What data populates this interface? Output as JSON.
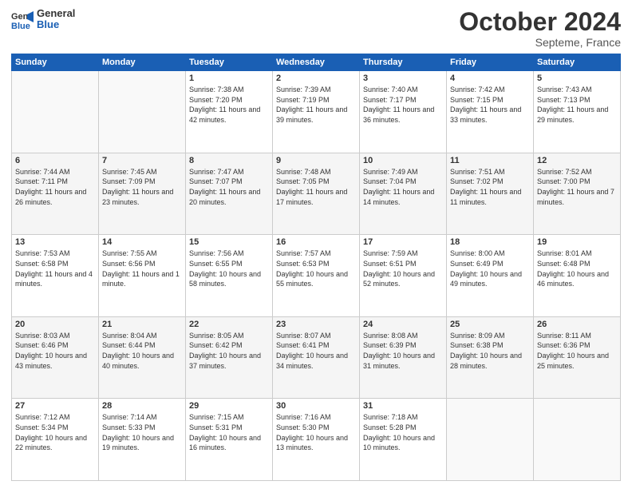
{
  "logo": {
    "line1": "General",
    "line2": "Blue"
  },
  "title": {
    "month": "October 2024",
    "location": "Septeme, France"
  },
  "weekdays": [
    "Sunday",
    "Monday",
    "Tuesday",
    "Wednesday",
    "Thursday",
    "Friday",
    "Saturday"
  ],
  "weeks": [
    [
      {
        "day": "",
        "sunrise": "",
        "sunset": "",
        "daylight": ""
      },
      {
        "day": "",
        "sunrise": "",
        "sunset": "",
        "daylight": ""
      },
      {
        "day": "1",
        "sunrise": "Sunrise: 7:38 AM",
        "sunset": "Sunset: 7:20 PM",
        "daylight": "Daylight: 11 hours and 42 minutes."
      },
      {
        "day": "2",
        "sunrise": "Sunrise: 7:39 AM",
        "sunset": "Sunset: 7:19 PM",
        "daylight": "Daylight: 11 hours and 39 minutes."
      },
      {
        "day": "3",
        "sunrise": "Sunrise: 7:40 AM",
        "sunset": "Sunset: 7:17 PM",
        "daylight": "Daylight: 11 hours and 36 minutes."
      },
      {
        "day": "4",
        "sunrise": "Sunrise: 7:42 AM",
        "sunset": "Sunset: 7:15 PM",
        "daylight": "Daylight: 11 hours and 33 minutes."
      },
      {
        "day": "5",
        "sunrise": "Sunrise: 7:43 AM",
        "sunset": "Sunset: 7:13 PM",
        "daylight": "Daylight: 11 hours and 29 minutes."
      }
    ],
    [
      {
        "day": "6",
        "sunrise": "Sunrise: 7:44 AM",
        "sunset": "Sunset: 7:11 PM",
        "daylight": "Daylight: 11 hours and 26 minutes."
      },
      {
        "day": "7",
        "sunrise": "Sunrise: 7:45 AM",
        "sunset": "Sunset: 7:09 PM",
        "daylight": "Daylight: 11 hours and 23 minutes."
      },
      {
        "day": "8",
        "sunrise": "Sunrise: 7:47 AM",
        "sunset": "Sunset: 7:07 PM",
        "daylight": "Daylight: 11 hours and 20 minutes."
      },
      {
        "day": "9",
        "sunrise": "Sunrise: 7:48 AM",
        "sunset": "Sunset: 7:05 PM",
        "daylight": "Daylight: 11 hours and 17 minutes."
      },
      {
        "day": "10",
        "sunrise": "Sunrise: 7:49 AM",
        "sunset": "Sunset: 7:04 PM",
        "daylight": "Daylight: 11 hours and 14 minutes."
      },
      {
        "day": "11",
        "sunrise": "Sunrise: 7:51 AM",
        "sunset": "Sunset: 7:02 PM",
        "daylight": "Daylight: 11 hours and 11 minutes."
      },
      {
        "day": "12",
        "sunrise": "Sunrise: 7:52 AM",
        "sunset": "Sunset: 7:00 PM",
        "daylight": "Daylight: 11 hours and 7 minutes."
      }
    ],
    [
      {
        "day": "13",
        "sunrise": "Sunrise: 7:53 AM",
        "sunset": "Sunset: 6:58 PM",
        "daylight": "Daylight: 11 hours and 4 minutes."
      },
      {
        "day": "14",
        "sunrise": "Sunrise: 7:55 AM",
        "sunset": "Sunset: 6:56 PM",
        "daylight": "Daylight: 11 hours and 1 minute."
      },
      {
        "day": "15",
        "sunrise": "Sunrise: 7:56 AM",
        "sunset": "Sunset: 6:55 PM",
        "daylight": "Daylight: 10 hours and 58 minutes."
      },
      {
        "day": "16",
        "sunrise": "Sunrise: 7:57 AM",
        "sunset": "Sunset: 6:53 PM",
        "daylight": "Daylight: 10 hours and 55 minutes."
      },
      {
        "day": "17",
        "sunrise": "Sunrise: 7:59 AM",
        "sunset": "Sunset: 6:51 PM",
        "daylight": "Daylight: 10 hours and 52 minutes."
      },
      {
        "day": "18",
        "sunrise": "Sunrise: 8:00 AM",
        "sunset": "Sunset: 6:49 PM",
        "daylight": "Daylight: 10 hours and 49 minutes."
      },
      {
        "day": "19",
        "sunrise": "Sunrise: 8:01 AM",
        "sunset": "Sunset: 6:48 PM",
        "daylight": "Daylight: 10 hours and 46 minutes."
      }
    ],
    [
      {
        "day": "20",
        "sunrise": "Sunrise: 8:03 AM",
        "sunset": "Sunset: 6:46 PM",
        "daylight": "Daylight: 10 hours and 43 minutes."
      },
      {
        "day": "21",
        "sunrise": "Sunrise: 8:04 AM",
        "sunset": "Sunset: 6:44 PM",
        "daylight": "Daylight: 10 hours and 40 minutes."
      },
      {
        "day": "22",
        "sunrise": "Sunrise: 8:05 AM",
        "sunset": "Sunset: 6:42 PM",
        "daylight": "Daylight: 10 hours and 37 minutes."
      },
      {
        "day": "23",
        "sunrise": "Sunrise: 8:07 AM",
        "sunset": "Sunset: 6:41 PM",
        "daylight": "Daylight: 10 hours and 34 minutes."
      },
      {
        "day": "24",
        "sunrise": "Sunrise: 8:08 AM",
        "sunset": "Sunset: 6:39 PM",
        "daylight": "Daylight: 10 hours and 31 minutes."
      },
      {
        "day": "25",
        "sunrise": "Sunrise: 8:09 AM",
        "sunset": "Sunset: 6:38 PM",
        "daylight": "Daylight: 10 hours and 28 minutes."
      },
      {
        "day": "26",
        "sunrise": "Sunrise: 8:11 AM",
        "sunset": "Sunset: 6:36 PM",
        "daylight": "Daylight: 10 hours and 25 minutes."
      }
    ],
    [
      {
        "day": "27",
        "sunrise": "Sunrise: 7:12 AM",
        "sunset": "Sunset: 5:34 PM",
        "daylight": "Daylight: 10 hours and 22 minutes."
      },
      {
        "day": "28",
        "sunrise": "Sunrise: 7:14 AM",
        "sunset": "Sunset: 5:33 PM",
        "daylight": "Daylight: 10 hours and 19 minutes."
      },
      {
        "day": "29",
        "sunrise": "Sunrise: 7:15 AM",
        "sunset": "Sunset: 5:31 PM",
        "daylight": "Daylight: 10 hours and 16 minutes."
      },
      {
        "day": "30",
        "sunrise": "Sunrise: 7:16 AM",
        "sunset": "Sunset: 5:30 PM",
        "daylight": "Daylight: 10 hours and 13 minutes."
      },
      {
        "day": "31",
        "sunrise": "Sunrise: 7:18 AM",
        "sunset": "Sunset: 5:28 PM",
        "daylight": "Daylight: 10 hours and 10 minutes."
      },
      {
        "day": "",
        "sunrise": "",
        "sunset": "",
        "daylight": ""
      },
      {
        "day": "",
        "sunrise": "",
        "sunset": "",
        "daylight": ""
      }
    ]
  ]
}
